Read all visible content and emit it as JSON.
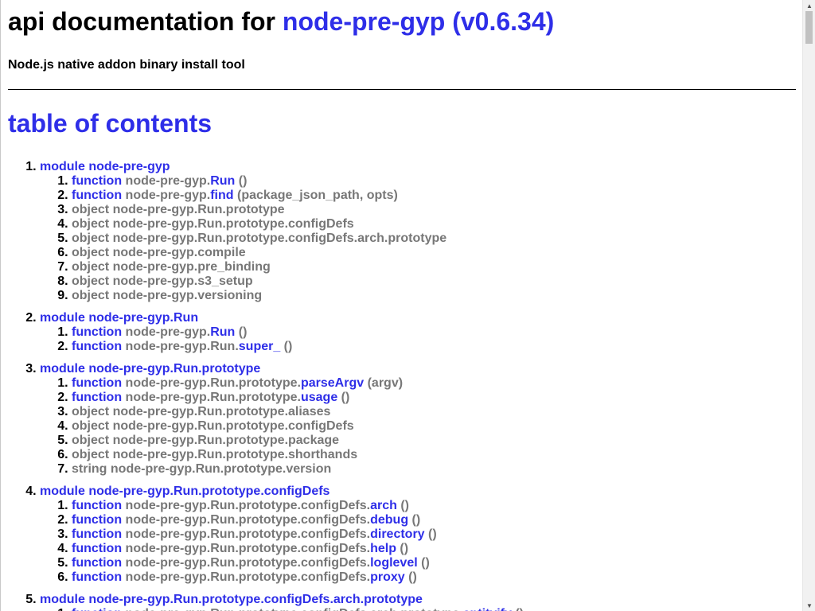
{
  "header": {
    "title_prefix": "api documentation for ",
    "title_link": "node-pre-gyp (v0.6.34)",
    "subtitle": "Node.js native addon binary install tool"
  },
  "toc": {
    "heading": "table of contents",
    "modules": [
      {
        "label": "module node-pre-gyp",
        "members": [
          {
            "kind": "function",
            "path": "node-pre-gyp.",
            "name": "Run",
            "args": " ()"
          },
          {
            "kind": "function",
            "path": "node-pre-gyp.",
            "name": "find",
            "args": " (package_json_path, opts)"
          },
          {
            "kind": "object",
            "path": "node-pre-gyp.Run.prototype",
            "name": "",
            "args": ""
          },
          {
            "kind": "object",
            "path": "node-pre-gyp.Run.prototype.configDefs",
            "name": "",
            "args": ""
          },
          {
            "kind": "object",
            "path": "node-pre-gyp.Run.prototype.configDefs.arch.prototype",
            "name": "",
            "args": ""
          },
          {
            "kind": "object",
            "path": "node-pre-gyp.compile",
            "name": "",
            "args": ""
          },
          {
            "kind": "object",
            "path": "node-pre-gyp.pre_binding",
            "name": "",
            "args": ""
          },
          {
            "kind": "object",
            "path": "node-pre-gyp.s3_setup",
            "name": "",
            "args": ""
          },
          {
            "kind": "object",
            "path": "node-pre-gyp.versioning",
            "name": "",
            "args": ""
          }
        ]
      },
      {
        "label": "module node-pre-gyp.Run",
        "members": [
          {
            "kind": "function",
            "path": "node-pre-gyp.",
            "name": "Run",
            "args": " ()"
          },
          {
            "kind": "function",
            "path": "node-pre-gyp.Run.",
            "name": "super_",
            "args": " ()"
          }
        ]
      },
      {
        "label": "module node-pre-gyp.Run.prototype",
        "members": [
          {
            "kind": "function",
            "path": "node-pre-gyp.Run.prototype.",
            "name": "parseArgv",
            "args": " (argv)"
          },
          {
            "kind": "function",
            "path": "node-pre-gyp.Run.prototype.",
            "name": "usage",
            "args": " ()"
          },
          {
            "kind": "object",
            "path": "node-pre-gyp.Run.prototype.aliases",
            "name": "",
            "args": ""
          },
          {
            "kind": "object",
            "path": "node-pre-gyp.Run.prototype.configDefs",
            "name": "",
            "args": ""
          },
          {
            "kind": "object",
            "path": "node-pre-gyp.Run.prototype.package",
            "name": "",
            "args": ""
          },
          {
            "kind": "object",
            "path": "node-pre-gyp.Run.prototype.shorthands",
            "name": "",
            "args": ""
          },
          {
            "kind": "string",
            "path": "node-pre-gyp.Run.prototype.version",
            "name": "",
            "args": ""
          }
        ]
      },
      {
        "label": "module node-pre-gyp.Run.prototype.configDefs",
        "members": [
          {
            "kind": "function",
            "path": "node-pre-gyp.Run.prototype.configDefs.",
            "name": "arch",
            "args": " ()"
          },
          {
            "kind": "function",
            "path": "node-pre-gyp.Run.prototype.configDefs.",
            "name": "debug",
            "args": " ()"
          },
          {
            "kind": "function",
            "path": "node-pre-gyp.Run.prototype.configDefs.",
            "name": "directory",
            "args": " ()"
          },
          {
            "kind": "function",
            "path": "node-pre-gyp.Run.prototype.configDefs.",
            "name": "help",
            "args": " ()"
          },
          {
            "kind": "function",
            "path": "node-pre-gyp.Run.prototype.configDefs.",
            "name": "loglevel",
            "args": " ()"
          },
          {
            "kind": "function",
            "path": "node-pre-gyp.Run.prototype.configDefs.",
            "name": "proxy",
            "args": " ()"
          }
        ]
      },
      {
        "label": "module node-pre-gyp.Run.prototype.configDefs.arch.prototype",
        "members": [
          {
            "kind": "function",
            "path": "node-pre-gyp.Run.prototype.configDefs.arch.prototype.",
            "name": "entityify",
            "args": " ()"
          }
        ]
      }
    ]
  },
  "colors": {
    "link": "#2e2ee8",
    "muted": "#777777"
  },
  "icons": {
    "scroll_up": "triangle-up-icon",
    "scroll_down": "triangle-down-icon"
  }
}
